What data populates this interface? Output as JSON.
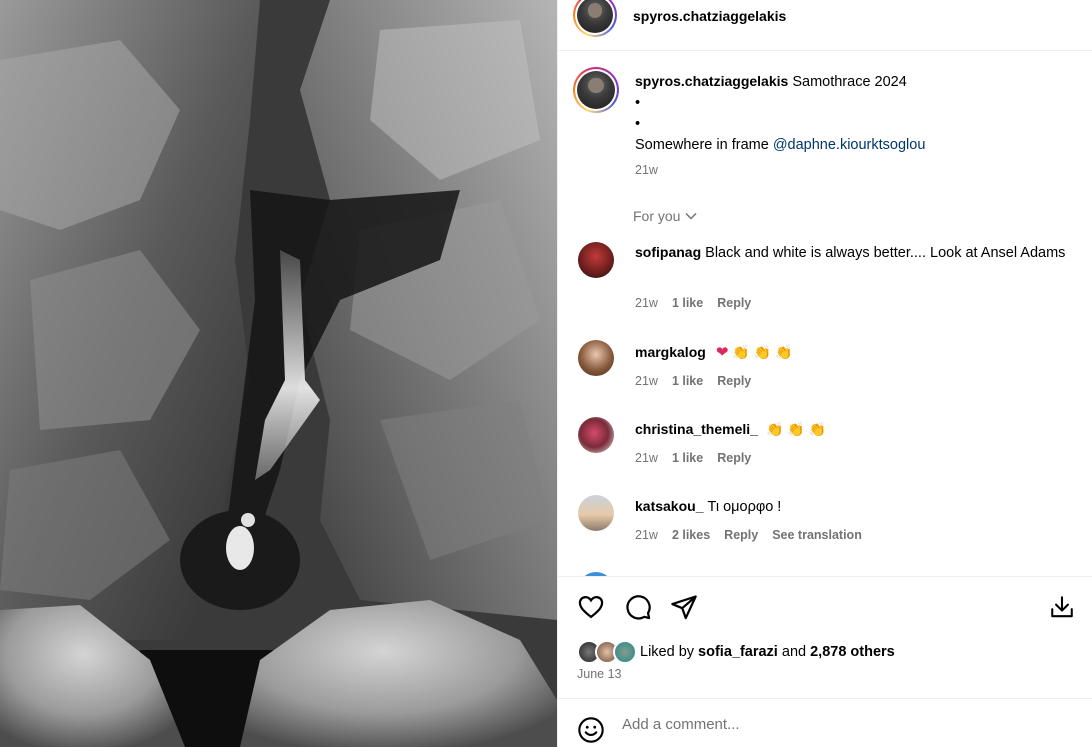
{
  "post": {
    "author": "spyros.chatziaggelakis",
    "caption": "Samothrace 2024",
    "caption_bullets": [
      "•",
      "•"
    ],
    "caption_line": "Somewhere in frame",
    "caption_mention": "@daphne.kiourktsoglou",
    "caption_age": "21w"
  },
  "comments_filter": "For you",
  "comments": [
    {
      "user": "sofipanag",
      "text": "Black and white is always better.... Look at Ansel Adams",
      "age": "21w",
      "likes": "1 like",
      "reply": "Reply"
    },
    {
      "user": "margkalog",
      "text": "",
      "emojis": [
        "heart",
        "clap",
        "clap",
        "clap"
      ],
      "age": "21w",
      "likes": "1 like",
      "reply": "Reply"
    },
    {
      "user": "christina_themeli_",
      "text": "",
      "emojis": [
        "clap",
        "clap",
        "clap"
      ],
      "age": "21w",
      "likes": "1 like",
      "reply": "Reply"
    },
    {
      "user": "katsakou_",
      "text": "Τι ομορφο !",
      "age": "21w",
      "likes": "2 likes",
      "reply": "Reply",
      "translate": "See translation"
    }
  ],
  "likes": {
    "prefix": "Liked by",
    "user": "sofia_farazi",
    "and": "and",
    "others": "2,878 others"
  },
  "date": "June 13",
  "add_comment_placeholder": "Add a comment...",
  "icons": {
    "like": "heart-icon",
    "comment": "comment-icon",
    "share": "share-icon",
    "save": "download-icon",
    "emoji": "emoji-icon",
    "chevron": "chevron-down-icon"
  },
  "colors": {
    "mention": "#00376b",
    "secondary_text": "#737373",
    "divider": "#efefef"
  }
}
